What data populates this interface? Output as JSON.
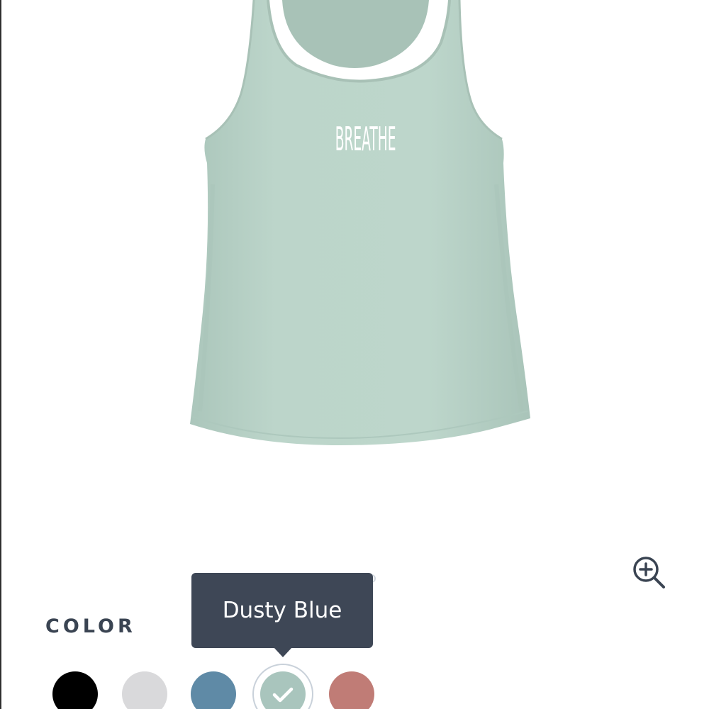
{
  "product": {
    "print_text": "BREATHE",
    "garment_color": "#b9d3c8"
  },
  "zoom": {
    "icon": "zoom-in-icon"
  },
  "color_picker": {
    "label": "COLOR",
    "selected_name": "Dusty Blue",
    "swatches": [
      {
        "color": "#000000",
        "selected": false
      },
      {
        "color": "#d9d9db",
        "selected": false
      },
      {
        "color": "#5f8aa6",
        "selected": false
      },
      {
        "color": "#a9c5bd",
        "selected": true
      },
      {
        "color": "#c07c76",
        "selected": false
      }
    ]
  },
  "colors": {
    "tooltip_bg": "#3e4756",
    "label_text": "#3a4452"
  }
}
